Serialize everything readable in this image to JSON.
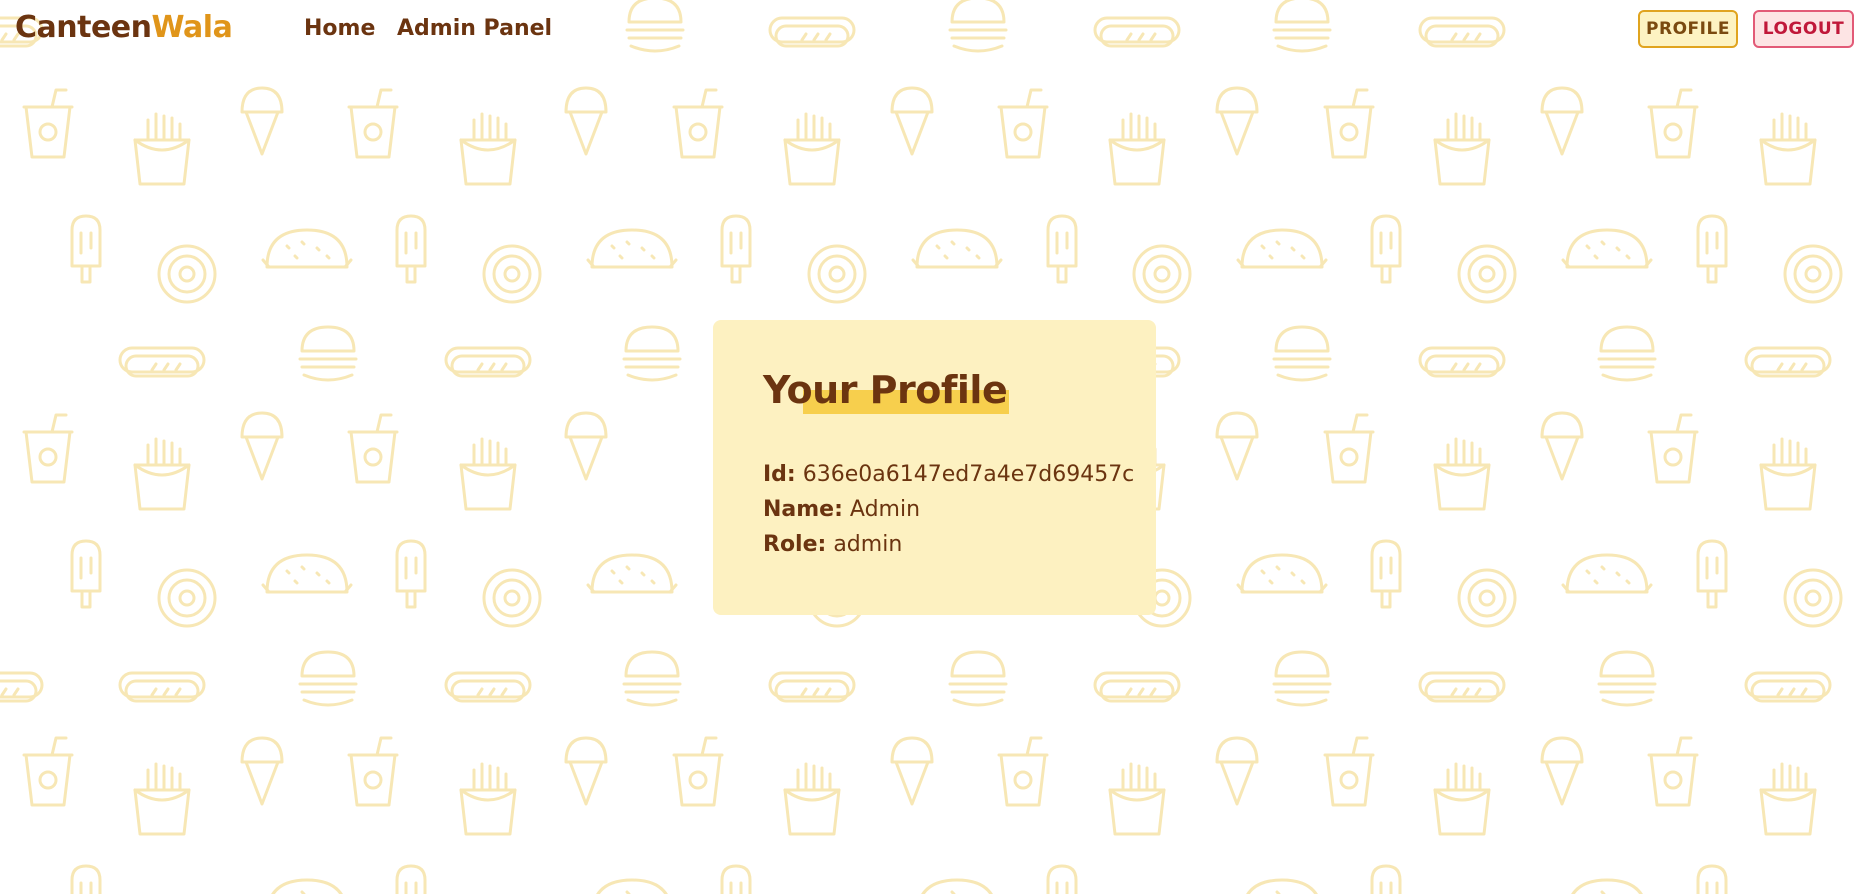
{
  "navbar": {
    "brand_primary": "Canteen",
    "brand_accent": "Wala",
    "links": [
      {
        "label": "Home"
      },
      {
        "label": "Admin Panel"
      }
    ],
    "profile_button": "PROFILE",
    "logout_button": "LOGOUT"
  },
  "profile": {
    "title": "Your Profile",
    "fields": [
      {
        "label": "Id:",
        "value": "636e0a6147ed7a4e7d69457c"
      },
      {
        "label": "Name:",
        "value": "Admin"
      },
      {
        "label": "Role:",
        "value": "admin"
      }
    ]
  },
  "colors": {
    "brand_brown": "#6b3410",
    "brand_orange": "#e0951a",
    "card_bg": "#fdf1c1",
    "highlight": "#f7cf4d",
    "pattern": "#f7e7b5",
    "logout_red": "#c0183a"
  },
  "background_icons": [
    "cup-icon",
    "fries-icon",
    "ice-cream-icon",
    "popsicle-icon",
    "donut-icon",
    "taco-icon",
    "burger-icon",
    "hotdog-icon"
  ]
}
